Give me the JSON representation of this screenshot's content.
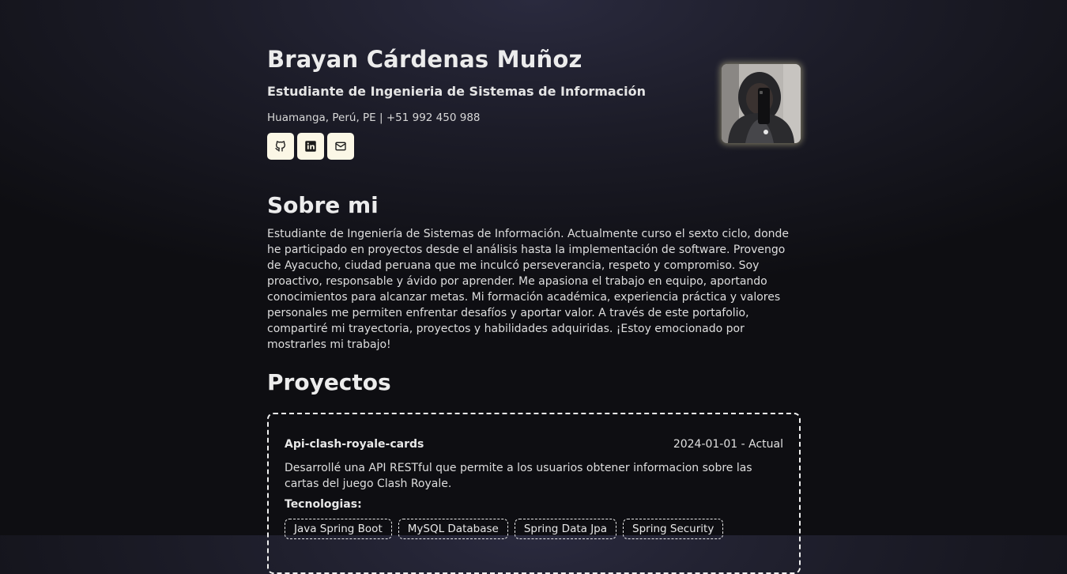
{
  "profile": {
    "name": "Brayan Cárdenas Muñoz",
    "subtitle": "Estudiante de Ingenieria de Sistemas de Información",
    "contact": "Huamanga, Perú, PE |  +51 992 450 988",
    "social": [
      {
        "icon": "github-icon"
      },
      {
        "icon": "linkedin-icon"
      },
      {
        "icon": "mail-icon"
      }
    ],
    "accent_color": "#fbf7e6"
  },
  "about": {
    "title": "Sobre mi",
    "text": "Estudiante de Ingeniería de Sistemas de Información. Actualmente curso el sexto ciclo, donde he participado en proyectos desde el análisis hasta la implementación de software. Provengo de Ayacucho, ciudad peruana que me inculcó perseverancia, respeto y compromiso. Soy proactivo, responsable y ávido por aprender. Me apasiona el trabajo en equipo, aportando conocimientos para alcanzar metas. Mi formación académica, experiencia práctica y valores personales me permiten enfrentar desafíos y aportar valor. A través de este portafolio, compartiré mi trayectoria, proyectos y habilidades adquiridas. ¡Estoy emocionado por mostrarles mi trabajo!"
  },
  "projects": {
    "title": "Proyectos",
    "items": [
      {
        "name": "Api-clash-royale-cards",
        "date": "2024-01-01 - Actual",
        "description": "Desarrollé una API RESTful que permite a los usuarios obtener informacion sobre las cartas del juego Clash Royale.",
        "tech_label": "Tecnologias:",
        "technologies": [
          "Java Spring Boot",
          "MySQL Database",
          "Spring Data Jpa",
          "Spring Security"
        ]
      }
    ]
  }
}
